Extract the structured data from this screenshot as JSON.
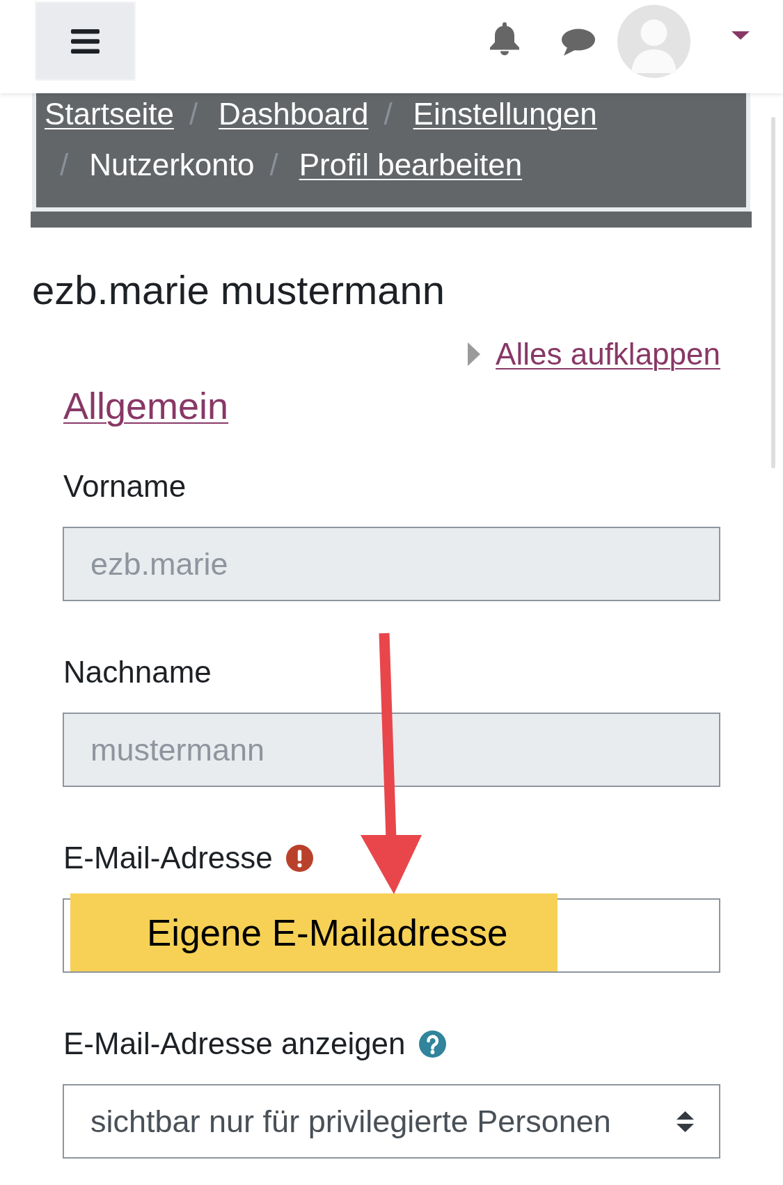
{
  "breadcrumb": [
    {
      "label": "Startseite",
      "kind": "link"
    },
    {
      "separator": "/",
      "label": "Dashboard",
      "kind": "link"
    },
    {
      "separator": "/",
      "label": "Einstellungen",
      "kind": "link"
    },
    {
      "separator": "/",
      "label": "Nutzerkonto",
      "kind": "text"
    },
    {
      "separator": "/",
      "label": "Profil bearbeiten",
      "kind": "link"
    }
  ],
  "page_title": "ezb.marie mustermann",
  "expand_all": {
    "label": "Alles aufklappen"
  },
  "section": {
    "title": "Allgemein"
  },
  "fields": [
    {
      "label": "Vorname",
      "kind": "text",
      "value": "ezb.marie",
      "disabled": true,
      "required": false,
      "help": false
    },
    {
      "label": "Nachname",
      "kind": "text",
      "value": "mustermann",
      "disabled": true,
      "required": false,
      "help": false
    },
    {
      "label": "E-Mail-Adresse",
      "kind": "text",
      "disabled": false,
      "required": true,
      "help": false
    },
    {
      "label": "E-Mail-Adresse anzeigen",
      "kind": "select",
      "value": "sichtbar nur für privilegierte Personen",
      "disabled": false,
      "required": false,
      "help": true
    }
  ],
  "annotation": {
    "label": "Eigene E-Mailadresse"
  }
}
